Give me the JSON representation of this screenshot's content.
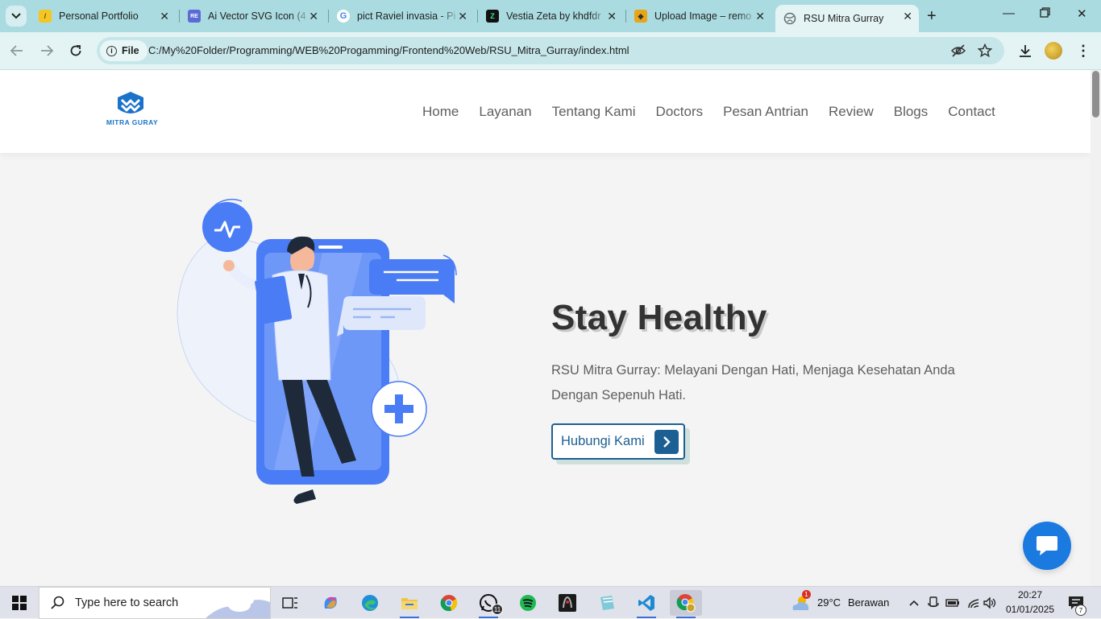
{
  "browser": {
    "tabs": [
      {
        "title": "Personal Portfolio",
        "favicon": "lightbulb-icon",
        "color": "#f3c623",
        "active": false
      },
      {
        "title": "Ai Vector SVG Icon (4",
        "favicon": "svgrepo-icon",
        "color": "#5b6bd6",
        "active": false
      },
      {
        "title": "pict Raviel invasia - Pi",
        "favicon": "google-icon",
        "color": "#4285f4",
        "active": false
      },
      {
        "title": "Vestia Zeta by khdfdr",
        "favicon": "pixiv-icon",
        "color": "#111111",
        "active": false
      },
      {
        "title": "Upload Image – remo",
        "favicon": "upload-image-icon",
        "color": "#e8a617",
        "active": false
      },
      {
        "title": "RSU Mitra Gurray",
        "favicon": "globe-icon",
        "color": "#5f6b6d",
        "active": true
      }
    ],
    "address": {
      "chip_label": "File",
      "url": "C:/My%20Folder/Programming/WEB%20Progamming/Frontend%20Web/RSU_Mitra_Gurray/index.html"
    }
  },
  "site": {
    "logo_text": "MITRA GURAY",
    "nav": [
      "Home",
      "Layanan",
      "Tentang Kami",
      "Doctors",
      "Pesan Antrian",
      "Review",
      "Blogs",
      "Contact"
    ],
    "hero": {
      "title": "Stay Healthy",
      "description": "RSU Mitra Gurray: Melayani Dengan Hati, Menjaga Kesehatan Anda Dengan Sepenuh Hati.",
      "cta_label": "Hubungi Kami"
    },
    "colors": {
      "primary": "#1c5f93",
      "accent": "#4a7cf5",
      "chat": "#1a7ae0"
    }
  },
  "taskbar": {
    "search_placeholder": "Type here to search",
    "whatsapp_badge": "11",
    "weather": {
      "badge": "1",
      "temp": "29°C",
      "condition": "Berawan"
    },
    "clock": {
      "time": "20:27",
      "date": "01/01/2025"
    },
    "notification_count": "7"
  }
}
